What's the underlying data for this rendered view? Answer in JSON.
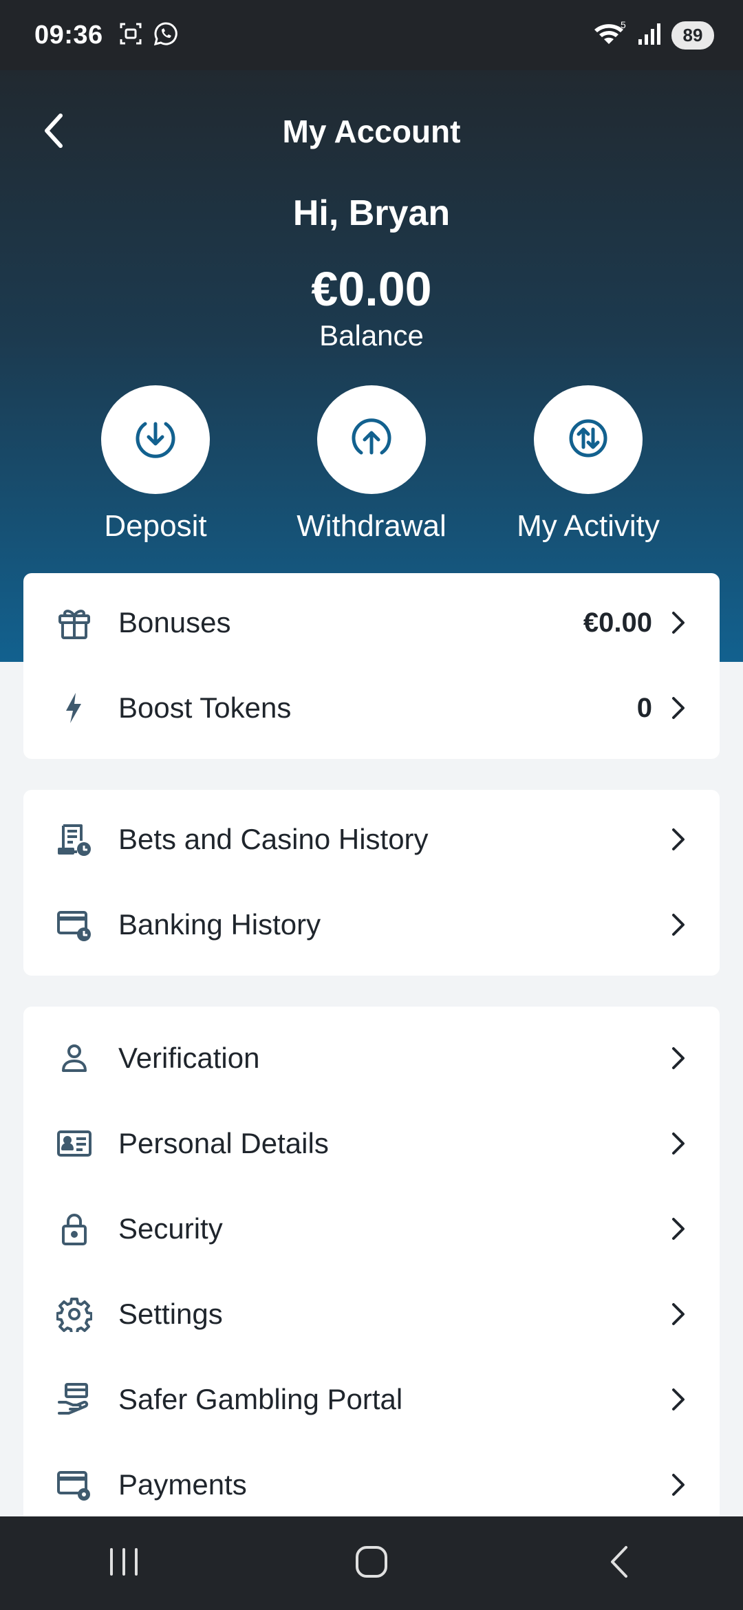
{
  "status_bar": {
    "time": "09:36",
    "battery": "89",
    "icons": [
      "screenshot-icon",
      "whatsapp-icon",
      "wifi-icon",
      "signal-icon"
    ]
  },
  "header": {
    "title": "My Account",
    "greeting": "Hi, Bryan",
    "balance_amount": "€0.00",
    "balance_label": "Balance"
  },
  "actions": [
    {
      "label": "Deposit",
      "icon": "download-icon"
    },
    {
      "label": "Withdrawal",
      "icon": "upload-icon"
    },
    {
      "label": "My Activity",
      "icon": "transfer-icon"
    }
  ],
  "rewards_card": [
    {
      "label": "Bonuses",
      "value": "€0.00",
      "icon": "gift-icon"
    },
    {
      "label": "Boost Tokens",
      "value": "0",
      "icon": "bolt-icon"
    }
  ],
  "history_card": [
    {
      "label": "Bets and Casino History",
      "icon": "receipt-clock-icon"
    },
    {
      "label": "Banking History",
      "icon": "card-clock-icon"
    }
  ],
  "settings_card": [
    {
      "label": "Verification",
      "icon": "user-icon"
    },
    {
      "label": "Personal Details",
      "icon": "id-card-icon"
    },
    {
      "label": "Security",
      "icon": "lock-icon"
    },
    {
      "label": "Settings",
      "icon": "gear-icon"
    },
    {
      "label": "Safer Gambling Portal",
      "icon": "hand-icon"
    },
    {
      "label": "Payments",
      "icon": "card-gear-icon"
    }
  ],
  "colors": {
    "icon": "#3f5a6e",
    "action_icon": "#12618f",
    "hero_top": "#212930",
    "hero_bottom": "#12618f"
  }
}
